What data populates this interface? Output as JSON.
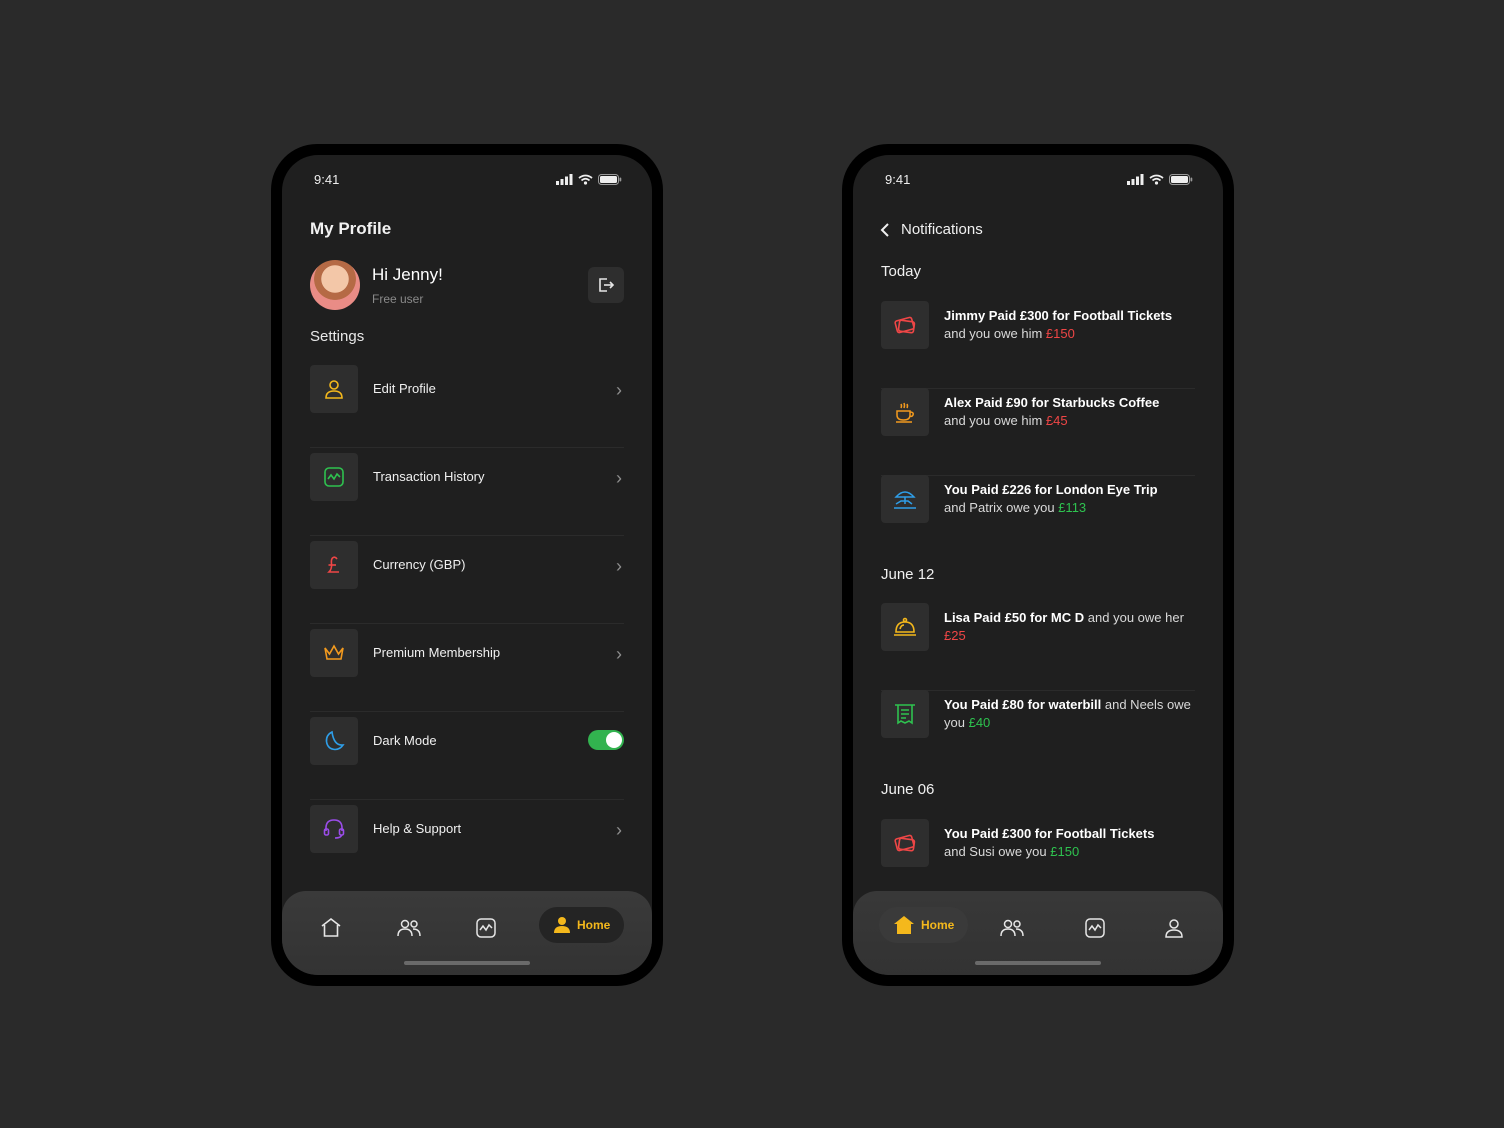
{
  "colors": {
    "background": "#2a2a2a",
    "screen": "#1f1f1f",
    "accent": "#f4b81c",
    "red": "#ef4646",
    "green": "#2ec24f",
    "toggle": "#32b34f"
  },
  "profile_screen": {
    "status_time": "9:41",
    "title": "My Profile",
    "greeting": "Hi Jenny!",
    "user_type": "Free user",
    "settings_label": "Settings",
    "menu": [
      {
        "label": "Edit Profile",
        "icon": "user-icon"
      },
      {
        "label": "Transaction History",
        "icon": "chart-icon"
      },
      {
        "label": "Currency (GBP)",
        "icon": "pound-icon"
      },
      {
        "label": "Premium Membership",
        "icon": "crown-icon"
      },
      {
        "label": "Dark Mode",
        "icon": "moon-icon",
        "toggle": "on"
      },
      {
        "label": "Help & Support",
        "icon": "headset-icon"
      }
    ],
    "tab_active": "Home"
  },
  "notifications_screen": {
    "status_time": "9:41",
    "title": "Notifications",
    "groups": [
      {
        "label": "Today",
        "items": [
          {
            "bold": "Jimmy Paid £300 for Football Tickets",
            "rest": "and you owe him",
            "amount": "£150",
            "amount_color": "red",
            "icon": "tickets-icon"
          },
          {
            "bold": "Alex Paid £90 for Starbucks Coffee",
            "rest": "and you owe him",
            "amount": "£45",
            "amount_color": "red",
            "icon": "coffee-icon"
          },
          {
            "bold": "You Paid £226 for London Eye Trip",
            "rest": "and Patrix owe you",
            "amount": "£113",
            "amount_color": "green",
            "icon": "beach-umbrella-icon"
          }
        ]
      },
      {
        "label": "June 12",
        "items": [
          {
            "bold": "Lisa Paid £50 for MC D",
            "rest": "and you owe her",
            "amount": "£25",
            "amount_color": "red",
            "icon": "food-cloche-icon"
          },
          {
            "bold": "You Paid £80 for waterbill",
            "rest": "and Neels owe you",
            "amount": "£40",
            "amount_color": "green",
            "icon": "receipt-icon"
          }
        ]
      },
      {
        "label": "June 06",
        "items": [
          {
            "bold": "You Paid £300 for Football Tickets",
            "rest": "and Susi owe you",
            "amount": "£150",
            "amount_color": "green",
            "icon": "tickets-icon"
          }
        ]
      }
    ],
    "tab_active": "Home"
  }
}
